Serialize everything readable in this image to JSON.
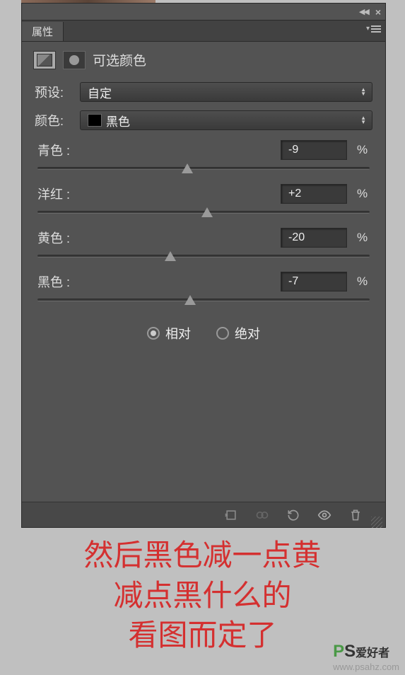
{
  "panel": {
    "tab_title": "属性",
    "adj_title": "可选颜色",
    "preset_label": "预设:",
    "preset_value": "自定",
    "color_label": "颜色:",
    "color_value": "黑色",
    "sliders": [
      {
        "label": "青色 :",
        "value": "-9",
        "pos": 45
      },
      {
        "label": "洋红 :",
        "value": "+2",
        "pos": 51
      },
      {
        "label": "黄色 :",
        "value": "-20",
        "pos": 40
      },
      {
        "label": "黑色 :",
        "value": "-7",
        "pos": 46
      }
    ],
    "percent": "%",
    "radio_relative": "相对",
    "radio_absolute": "绝对"
  },
  "annotation": {
    "line1": "然后黑色减一点黄",
    "line2": "减点黑什么的",
    "line3": "看图而定了"
  },
  "watermark": {
    "zh": "爱好者",
    "url": "www.psahz.com"
  }
}
